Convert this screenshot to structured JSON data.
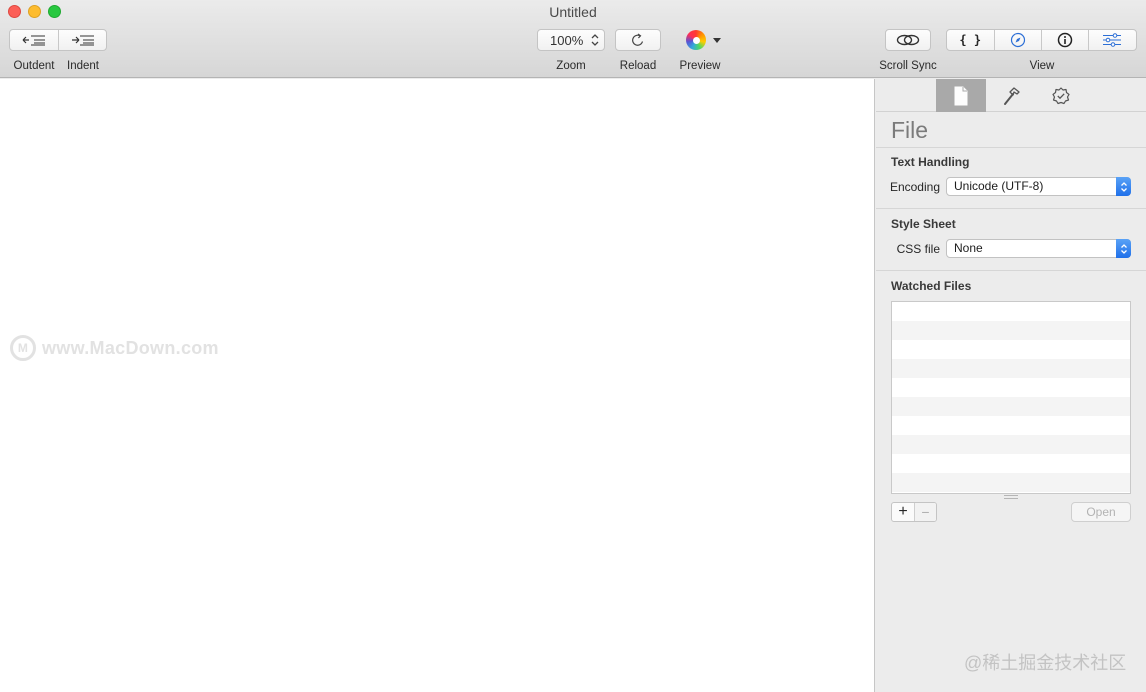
{
  "window": {
    "title": "Untitled"
  },
  "toolbar": {
    "outdent_label": "Outdent",
    "indent_label": "Indent",
    "zoom_value": "100%",
    "zoom_label": "Zoom",
    "reload_label": "Reload",
    "preview_label": "Preview",
    "scroll_sync_label": "Scroll Sync",
    "view_label": "View",
    "view_items": [
      "{ }",
      "compass-icon",
      "info-icon",
      "sliders-icon"
    ]
  },
  "editor": {
    "watermark": "www.MacDown.com",
    "watermark_logo": "M"
  },
  "sidebar": {
    "tabs": [
      "document-icon",
      "hammer-icon",
      "badge-check-icon"
    ],
    "active_tab": 0,
    "title": "File",
    "text_handling": {
      "heading": "Text Handling",
      "encoding_label": "Encoding",
      "encoding_value": "Unicode (UTF-8)"
    },
    "style_sheet": {
      "heading": "Style Sheet",
      "css_label": "CSS file",
      "css_value": "None"
    },
    "watched_files": {
      "heading": "Watched Files",
      "items": [],
      "add_symbol": "+",
      "remove_symbol": "−",
      "open_label": "Open"
    }
  },
  "site_mark": "@稀土掘金技术社区",
  "colors": {
    "accent": "#1f70ea",
    "active_tab": "#a9a9a9",
    "close": "#fc5f57",
    "minimize": "#fdbc2e",
    "maximize": "#28c840"
  }
}
